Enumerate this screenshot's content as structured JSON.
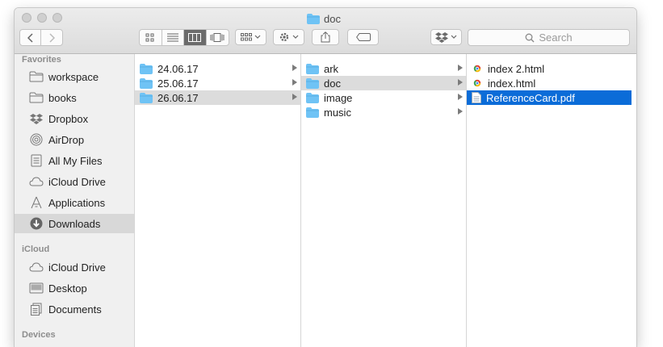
{
  "window": {
    "title": "doc"
  },
  "toolbar": {
    "back_label": "<",
    "forward_label": ">",
    "search_placeholder": "Search"
  },
  "sidebar": {
    "sections": [
      {
        "header": "Favorites",
        "items": [
          {
            "label": "workspace",
            "icon": "folder-icon"
          },
          {
            "label": "books",
            "icon": "folder-icon"
          },
          {
            "label": "Dropbox",
            "icon": "dropbox-icon"
          },
          {
            "label": "AirDrop",
            "icon": "airdrop-icon"
          },
          {
            "label": "All My Files",
            "icon": "all-files-icon"
          },
          {
            "label": "iCloud Drive",
            "icon": "cloud-icon"
          },
          {
            "label": "Applications",
            "icon": "applications-icon"
          },
          {
            "label": "Downloads",
            "icon": "downloads-icon",
            "selected": true
          }
        ]
      },
      {
        "header": "iCloud",
        "items": [
          {
            "label": "iCloud Drive",
            "icon": "cloud-icon"
          },
          {
            "label": "Desktop",
            "icon": "desktop-icon"
          },
          {
            "label": "Documents",
            "icon": "documents-icon"
          }
        ]
      },
      {
        "header": "Devices",
        "items": []
      }
    ]
  },
  "columns": [
    {
      "items": [
        {
          "label": "24.06.17",
          "type": "folder"
        },
        {
          "label": "25.06.17",
          "type": "folder"
        },
        {
          "label": "26.06.17",
          "type": "folder",
          "selected": "grey"
        }
      ]
    },
    {
      "items": [
        {
          "label": "ark",
          "type": "folder"
        },
        {
          "label": "doc",
          "type": "folder",
          "selected": "grey"
        },
        {
          "label": "image",
          "type": "folder"
        },
        {
          "label": "music",
          "type": "folder"
        }
      ]
    },
    {
      "items": [
        {
          "label": "index 2.html",
          "type": "html"
        },
        {
          "label": "index.html",
          "type": "html"
        },
        {
          "label": "ReferenceCard.pdf",
          "type": "pdf",
          "selected": "blue"
        }
      ]
    }
  ],
  "colors": {
    "selection_blue": "#0b6cd8",
    "folder_blue": "#6fc3f5",
    "sidebar_bg": "#f0f0f0"
  }
}
